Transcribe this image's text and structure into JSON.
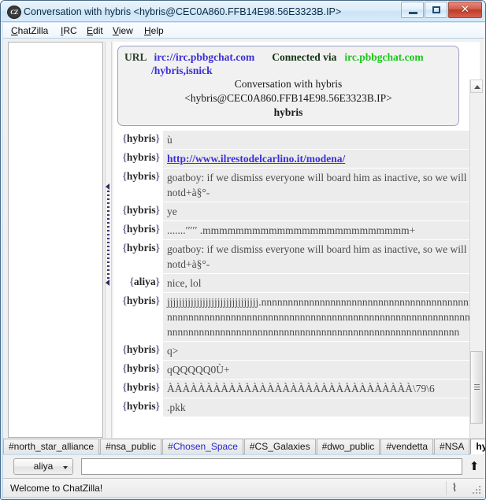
{
  "window": {
    "title": "Conversation with hybris <hybris@CEC0A860.FFB14E98.56E3323B.IP>",
    "app_icon": "CZ",
    "controls": {
      "minimize": "minimize-icon",
      "maximize": "maximize-icon",
      "close": "✕"
    }
  },
  "menubar": {
    "items": [
      {
        "pre": "",
        "key": "C",
        "post": "hatZilla"
      },
      {
        "pre": "",
        "key": "I",
        "post": "RC"
      },
      {
        "pre": "",
        "key": "E",
        "post": "dit"
      },
      {
        "pre": "",
        "key": "V",
        "post": "iew"
      },
      {
        "pre": "",
        "key": "H",
        "post": "elp"
      }
    ]
  },
  "header": {
    "url_label": "URL",
    "url_value": "irc://irc.pbbgchat.com",
    "connected_label": "Connected via",
    "server": "irc.pbbgchat.com",
    "url_line2": "/hybris,isnick",
    "title_line": "Conversation with hybris",
    "host_line": "<hybris@CEC0A860.FFB14E98.56E3323B.IP>",
    "nick_line": "hybris"
  },
  "messages": [
    {
      "nick": "hybris",
      "text": "ù",
      "style": "normal"
    },
    {
      "nick": "hybris",
      "text": "http://www.ilrestodelcarlino.it/modena/",
      "style": "link"
    },
    {
      "nick": "hybris",
      "text": "goatboy: if we dismiss everyone will board him as inactive, so we will notd+à§°-",
      "style": "normal"
    },
    {
      "nick": "hybris",
      "text": "ye",
      "style": "normal"
    },
    {
      "nick": "hybris",
      "text": ".......′′′′′ .mmmmmmmmmmmmmmmmmmmmmmmmm+",
      "style": "normal"
    },
    {
      "nick": "hybris",
      "text": "goatboy: if we dismiss everyone will board him as inactive, so we will notd+à§°-",
      "style": "normal"
    },
    {
      "nick": "aliya",
      "text": "nice, lol",
      "style": "normal"
    },
    {
      "nick": "hybris",
      "text": " jjjjjjjjjjjjjjjjjjjjjjjjjjjjjjj.nnnnnnnnnnnnnnnnnnnnnnnnnnnnnnnnnnnnnnnnnnnnnnnnnnnnnnnnnnnnnnnnnnnnnnnnnnnnnnnnnnnnnnnnnnnnnnnnnnnnnnnnnnnnnnnnnnnnnnnnnnnnnnnnnnnnnnnnnnnnnnnnnnnnnnnnn",
      "style": "normal"
    },
    {
      "nick": "hybris",
      "text": "q>",
      "style": "normal"
    },
    {
      "nick": "hybris",
      "text": "qQQQQQ0Ù+",
      "style": "normal"
    },
    {
      "nick": "hybris",
      "text": "ÀÀÀÀÀÀÀÀÀÀÀÀÀÀÀÀÀÀÀÀÀÀÀÀÀÀÀÀÀÀÀÀ\\79\\6",
      "style": "normal"
    },
    {
      "nick": "hybris",
      "text": ".pkk",
      "style": "normal"
    }
  ],
  "tabs": [
    {
      "label": "#north_star_alliance",
      "state": "normal"
    },
    {
      "label": "#nsa_public",
      "state": "normal"
    },
    {
      "label": "#Chosen_Space",
      "state": "activity"
    },
    {
      "label": "#CS_Galaxies",
      "state": "normal"
    },
    {
      "label": "#dwo_public",
      "state": "normal"
    },
    {
      "label": "#vendetta",
      "state": "normal"
    },
    {
      "label": "#NSA",
      "state": "normal"
    },
    {
      "label": "hybris",
      "state": "selected"
    }
  ],
  "input": {
    "nick_button": "aliya",
    "value": "",
    "placeholder": "",
    "send_icon": "⬆"
  },
  "statusbar": {
    "text": "Welcome to ChatZilla!",
    "icon": "⌇"
  },
  "colors": {
    "link": "#3b2fd6",
    "server_green": "#1ac71a",
    "tab_activity": "#2727cf",
    "nick_brace": "#6e6e9a",
    "msg_bg": "#ececec"
  }
}
